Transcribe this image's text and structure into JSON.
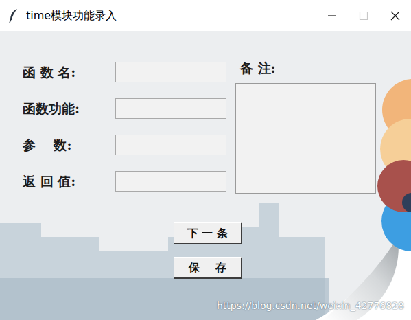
{
  "window": {
    "title": "time模块功能录入",
    "controls": [
      {
        "kind": "minimize",
        "disabled": false
      },
      {
        "kind": "maximize",
        "disabled": true
      },
      {
        "kind": "close",
        "disabled": false
      }
    ]
  },
  "fields": [
    {
      "label": "函 数 名:",
      "value": ""
    },
    {
      "label": "函数功能:",
      "value": ""
    },
    {
      "label": "参    数:",
      "value": ""
    },
    {
      "label": "返 回 值:",
      "value": ""
    }
  ],
  "notes": {
    "label": "备 注:",
    "value": ""
  },
  "buttons": [
    "下 一 条",
    "保    存"
  ],
  "watermark": "https://blog.csdn.net/weixin_42776828"
}
